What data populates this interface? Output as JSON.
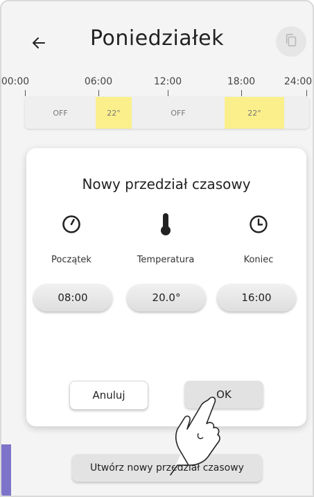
{
  "header": {
    "title": "Poniedziałek",
    "back_icon": "arrow-left-icon",
    "copy_icon": "copy-icon"
  },
  "timeline": {
    "labels": [
      "00:00",
      "06:00",
      "12:00",
      "18:00",
      "24:00"
    ],
    "segments": [
      {
        "label": "OFF",
        "state": "off"
      },
      {
        "label": "22°",
        "state": "on"
      },
      {
        "label": "OFF",
        "state": "off"
      },
      {
        "label": "22°",
        "state": "on"
      }
    ],
    "on_color": "#fbef8c"
  },
  "dialog": {
    "title": "Nowy przedział czasowy",
    "columns": [
      {
        "icon": "timer-icon",
        "label": "Początek",
        "value": "08:00"
      },
      {
        "icon": "thermometer-icon",
        "label": "Temperatura",
        "value": "20.0°"
      },
      {
        "icon": "clock-icon",
        "label": "Koniec",
        "value": "16:00"
      }
    ],
    "cancel_label": "Anuluj",
    "ok_label": "OK"
  },
  "footer": {
    "new_interval_label": "Utwórz nowy przedział czasowy"
  },
  "colors": {
    "accent": "#7d73c9",
    "background": "#f4f4f4"
  }
}
